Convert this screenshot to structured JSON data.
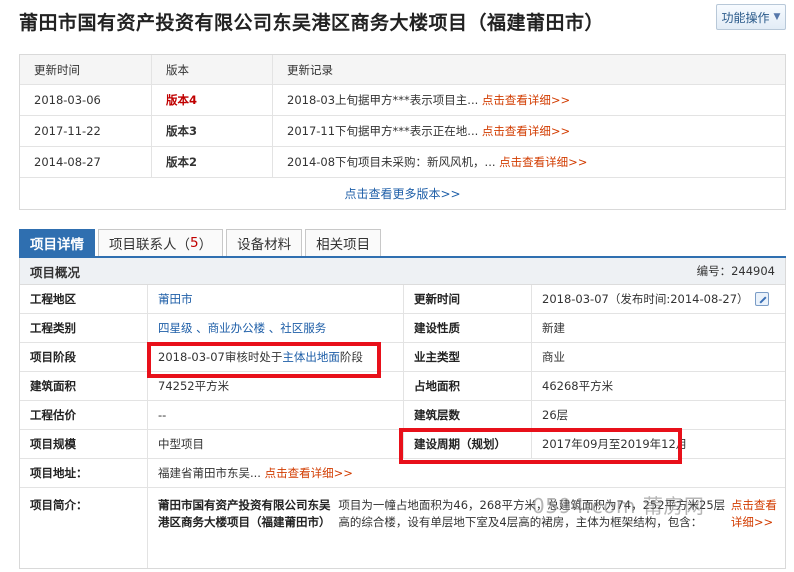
{
  "page": {
    "title": "莆田市国有资产投资有限公司东吴港区商务大楼项目（福建莆田市）",
    "function_button": "功能操作"
  },
  "versions": {
    "headers": [
      "更新时间",
      "版本",
      "更新记录"
    ],
    "rows": [
      {
        "date": "2018-03-06",
        "version": "版本4",
        "record": "2018-03上旬据甲方***表示项目主...",
        "link": "点击查看详细>>"
      },
      {
        "date": "2017-11-22",
        "version": "版本3",
        "record": "2017-11下旬据甲方***表示正在地...",
        "link": "点击查看详细>>"
      },
      {
        "date": "2014-08-27",
        "version": "版本2",
        "record": "2014-08下旬项目未采购：新风风机，...",
        "link": "点击查看详细>>"
      }
    ],
    "more": "点击查看更多版本>>"
  },
  "tabs": [
    {
      "label": "项目详情"
    },
    {
      "label": "项目联系人（",
      "count": "5",
      "suffix": "）"
    },
    {
      "label": "设备材料"
    },
    {
      "label": "相关项目"
    }
  ],
  "overview": {
    "title": "项目概况",
    "number": "编号：244904"
  },
  "fields": {
    "location_label": "工程地区",
    "location_value": "莆田市",
    "updated_label": "更新时间",
    "updated_value": "2018-03-07（发布时间:2014-08-27）",
    "category_label": "工程类别",
    "category_value": "四星级 、商业办公楼 、社区服务",
    "nature_label": "建设性质",
    "nature_value": "新建",
    "stage_label": "项目阶段",
    "stage_prefix": "2018-03-07审核时处于",
    "stage_link": "主体出地面",
    "stage_suffix": "阶段",
    "owner_type_label": "业主类型",
    "owner_type_value": "商业",
    "area_label": "建筑面积",
    "area_value": "74252平方米",
    "land_label": "占地面积",
    "land_value": "46268平方米",
    "estimate_label": "工程估价",
    "estimate_value": "--",
    "floors_label": "建筑层数",
    "floors_value": "26层",
    "scale_label": "项目规模",
    "scale_value": "中型项目",
    "period_label": "建设周期（规划）",
    "period_value": "2017年09月至2019年12月",
    "address_label": "项目地址：",
    "address_value": "福建省莆田市东吴...",
    "address_link": "点击查看详细>>",
    "intro_label": "项目简介：",
    "intro_head": "莆田市国有资产投资有限公司东吴港区商务大楼项目（福建莆田市）",
    "intro_text": "项目为一幢占地面积为46，268平方米，总建筑面积为74，252平方米25层高的综合楼，设有单层地下室及4层高的裙房，主体为框架结构，包含：",
    "intro_link": "点击查看详细>>"
  },
  "watermark": "0594.com 莆房网",
  "colors": {
    "accent": "#2f6fb0",
    "highlight": "#e8101a",
    "link_red": "#d23c00",
    "version_red": "#c00000"
  }
}
